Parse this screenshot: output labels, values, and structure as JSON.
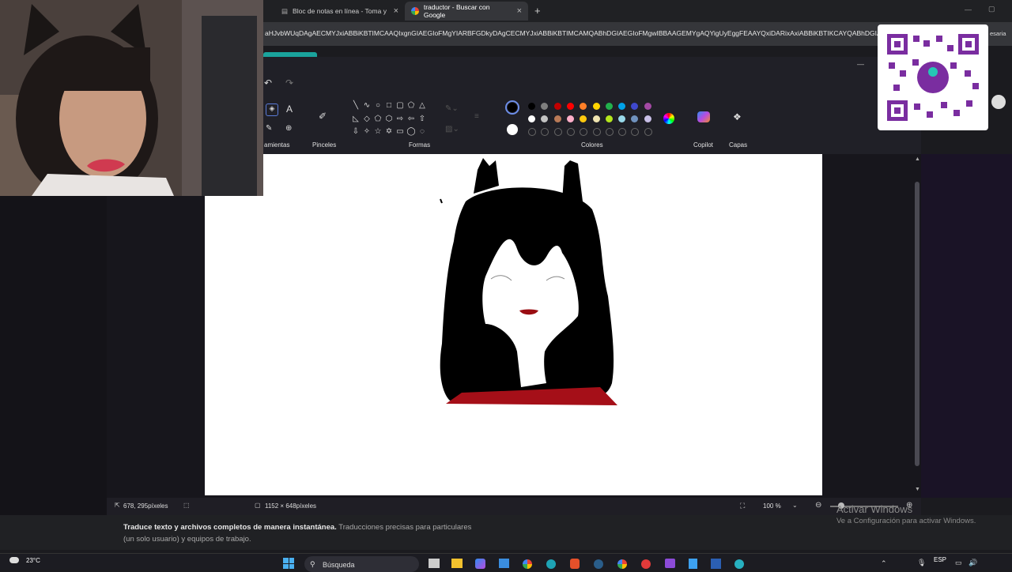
{
  "browser": {
    "tabs": [
      {
        "label": "Bloc de notas en línea - Toma y"
      },
      {
        "label": "traductor - Buscar con Google"
      }
    ],
    "new_tab": "+",
    "url": "aHJvbWUqDAgAECMYJxiABBiKBTIMCAAQIxgnGIAEGIoFMgYIARBFGDkyDAgCECMYJxiABBiKBTIMCAMQABhDGIAEGIoFMgwIBBAAGEMYgAQYigUyEggFEAAYQxiDARixAxiABBiKBTIKCAYQABhDGIAE",
    "url_right": "esaria"
  },
  "paint": {
    "undo": "↶",
    "redo": "↷",
    "groups": {
      "tools": "amientas",
      "brushes": "Pinceles",
      "shapes": "Formas",
      "colors": "Colores",
      "copilot": "Copilot",
      "layers": "Capas"
    },
    "colors_row1": [
      "#000000",
      "#7f7f7f",
      "#c00000",
      "#ff0000",
      "#ff7f27",
      "#ffd400",
      "#22b14c",
      "#00a2e8",
      "#3f48cc",
      "#a349a4"
    ],
    "colors_row2": [
      "#ffffff",
      "#c3c3c3",
      "#b97a57",
      "#ffaec9",
      "#ffc90e",
      "#efe4b0",
      "#b5e61d",
      "#99d9ea",
      "#7092be",
      "#c8bfe7"
    ],
    "primary_color": "#000000",
    "secondary_color": "#ffffff",
    "status": {
      "cursor_pos": "678, 295píxeles",
      "canvas_size": "1152 × 648píxeles",
      "zoom": "100 %"
    }
  },
  "page": {
    "promo_bold": "Traduce texto y archivos completos de manera instantánea.",
    "promo_rest": " Traducciones precisas para particulares",
    "promo_line2": "(un solo usuario) y equipos de trabajo.",
    "watermark_title": "Activar Windows",
    "watermark_sub": "Ve a Configuración para activar Windows."
  },
  "taskbar": {
    "weather_temp": "23°C",
    "search": "Búsqueda",
    "lang": "ESP"
  }
}
